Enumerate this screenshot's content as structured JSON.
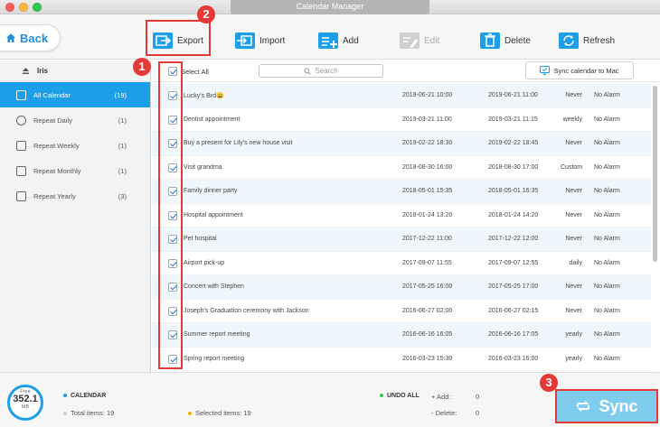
{
  "window": {
    "title": "Calendar Manager"
  },
  "toolbar": {
    "back_label": "Back",
    "export_label": "Export",
    "import_label": "Import",
    "add_label": "Add",
    "edit_label": "Edit",
    "delete_label": "Delete",
    "refresh_label": "Refresh"
  },
  "callouts": [
    "1",
    "2",
    "3"
  ],
  "sidebar": {
    "account": "Iris",
    "items": [
      {
        "label": "All Calendar",
        "count": "(19)",
        "icon": "calendar-icon",
        "active": true
      },
      {
        "label": "Repeat Daily",
        "count": "(1)",
        "icon": "clock-icon"
      },
      {
        "label": "Repeat Weekly",
        "count": "(1)",
        "icon": "calendar-7-icon"
      },
      {
        "label": "Repeat Monthly",
        "count": "(1)",
        "icon": "calendar-31-icon"
      },
      {
        "label": "Repeat Yearly",
        "count": "(3)",
        "icon": "calendar-365-icon"
      }
    ]
  },
  "list": {
    "select_all_label": "Select All",
    "search_placeholder": "Search",
    "sync_to_mac_label": "Sync calendar to Mac",
    "rows": [
      {
        "name": "Lucky's Brd😀",
        "start": "2019-06-21 10:00",
        "end": "2019-06-21 11:00",
        "repeat": "Never",
        "alarm": "No Alarm"
      },
      {
        "name": "Dentist appointment",
        "start": "2019-03-21 11:00",
        "end": "2019-03-21 11:15",
        "repeat": "weekly",
        "alarm": "No Alarm"
      },
      {
        "name": "Buy a present for Lily's new house visit",
        "start": "2019-02-22 18:30",
        "end": "2019-02-22 18:45",
        "repeat": "Never",
        "alarm": "No Alarm"
      },
      {
        "name": "Visit grandma",
        "start": "2018-08-30 16:00",
        "end": "2018-08-30 17:00",
        "repeat": "Custom",
        "alarm": "No Alarm"
      },
      {
        "name": "Family dinner party",
        "start": "2018-05-01 15:35",
        "end": "2018-05-01 16:35",
        "repeat": "Never",
        "alarm": "No Alarm"
      },
      {
        "name": "Hospital appointment",
        "start": "2018-01-24 13:20",
        "end": "2018-01-24 14:20",
        "repeat": "Never",
        "alarm": "No Alarm"
      },
      {
        "name": "Pet hospital",
        "start": "2017-12-22 11:00",
        "end": "2017-12-22 12:00",
        "repeat": "Never",
        "alarm": "No Alarm"
      },
      {
        "name": "Airport pick-up",
        "start": "2017-09-07 11:55",
        "end": "2017-09-07 12:55",
        "repeat": "daily",
        "alarm": "No Alarm"
      },
      {
        "name": "Concert with Stephen",
        "start": "2017-05-25 16:00",
        "end": "2017-05-25 17:00",
        "repeat": "Never",
        "alarm": "No Alarm"
      },
      {
        "name": "Joseph's Graduation ceremony with Jackson",
        "start": "2016-06-27 02:00",
        "end": "2016-06-27 02:15",
        "repeat": "Never",
        "alarm": "No Alarm"
      },
      {
        "name": "Summer report meeting",
        "start": "2016-06-16 16:05",
        "end": "2016-06-16 17:05",
        "repeat": "yearly",
        "alarm": "No Alarm"
      },
      {
        "name": "Spring report meeting",
        "start": "2016-03-23 15:30",
        "end": "2016-03-23 16:00",
        "repeat": "yearly",
        "alarm": "No Alarm"
      }
    ]
  },
  "footer": {
    "free_label": "Free",
    "free_value": "352.1",
    "free_unit": "MB",
    "calendar_label": "CALENDAR",
    "total_label": "Total items: 19",
    "selected_label": "Selected items: 19",
    "undo_label": "UNDO ALL",
    "add_label": "+ Add:",
    "add_value": "0",
    "delete_label": "- Delete:",
    "delete_value": "0",
    "sync_label": "Sync"
  },
  "colors": {
    "accent": "#1c9ee8",
    "callout": "#e53935",
    "sync": "#7fccef"
  }
}
